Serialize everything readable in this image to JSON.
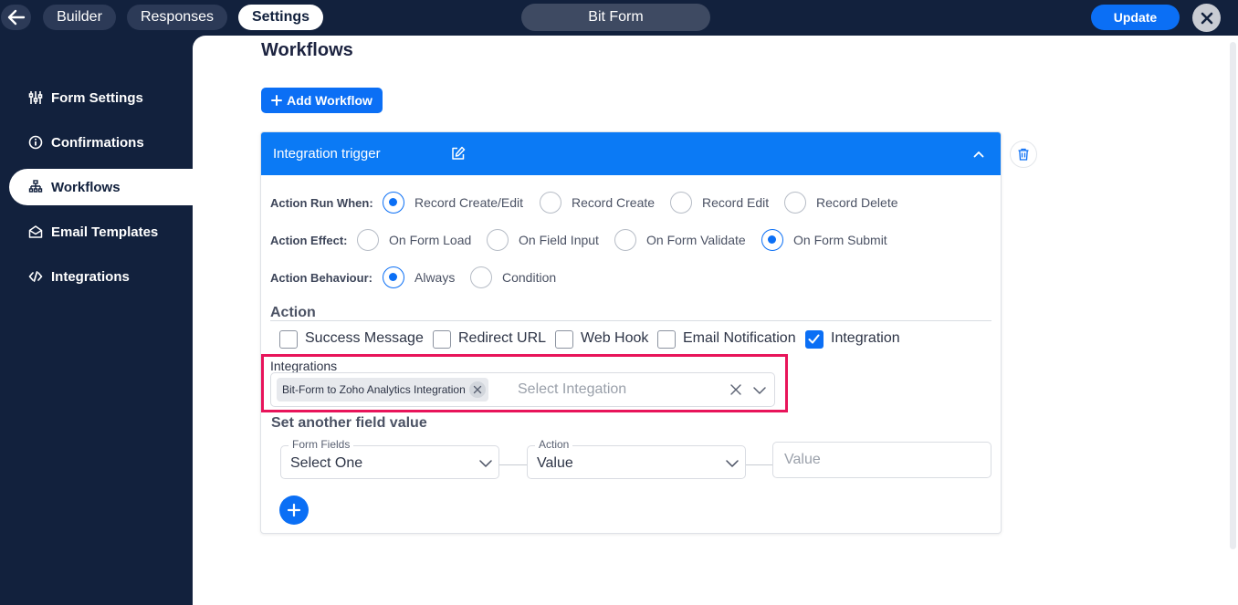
{
  "topbar": {
    "tabs": [
      {
        "label": "Builder",
        "active": false
      },
      {
        "label": "Responses",
        "active": false
      },
      {
        "label": "Settings",
        "active": true
      }
    ],
    "form_title": "Bit Form",
    "update_label": "Update"
  },
  "sidebar": {
    "items": [
      {
        "label": "Form Settings",
        "icon": "sliders-icon",
        "active": false
      },
      {
        "label": "Confirmations",
        "icon": "info-circle-icon",
        "active": false
      },
      {
        "label": "Workflows",
        "icon": "sitemap-icon",
        "active": true
      },
      {
        "label": "Email Templates",
        "icon": "envelope-open-icon",
        "active": false
      },
      {
        "label": "Integrations",
        "icon": "code-icon",
        "active": false
      }
    ]
  },
  "main": {
    "title": "Workflows",
    "add_workflow_label": "Add Workflow",
    "workflow": {
      "title": "Integration trigger",
      "run_when": {
        "label": "Action Run When:",
        "options": [
          "Record Create/Edit",
          "Record Create",
          "Record Edit",
          "Record Delete"
        ],
        "selected": "Record Create/Edit"
      },
      "effect": {
        "label": "Action Effect:",
        "options": [
          "On Form Load",
          "On Field Input",
          "On Form Validate",
          "On Form Submit"
        ],
        "selected": "On Form Submit"
      },
      "behaviour": {
        "label": "Action Behaviour:",
        "options": [
          "Always",
          "Condition"
        ],
        "selected": "Always"
      },
      "action": {
        "title": "Action",
        "checks": [
          {
            "label": "Success Message",
            "checked": false
          },
          {
            "label": "Redirect URL",
            "checked": false
          },
          {
            "label": "Web Hook",
            "checked": false
          },
          {
            "label": "Email Notification",
            "checked": false
          },
          {
            "label": "Integration",
            "checked": true
          }
        ]
      },
      "integrations": {
        "label": "Integrations",
        "selected_chip": "Bit-Form to Zoho Analytics Integration",
        "placeholder": "Select Integation"
      },
      "set_field": {
        "title": "Set another field value",
        "form_fields_legend": "Form Fields",
        "form_fields_value": "Select One",
        "action_legend": "Action",
        "action_value": "Value",
        "value_placeholder": "Value"
      }
    }
  },
  "colors": {
    "sidebar_bg": "#12213d",
    "accent": "#0b6ff5",
    "card_header": "#0b7af5",
    "highlight": "#e8145a"
  }
}
